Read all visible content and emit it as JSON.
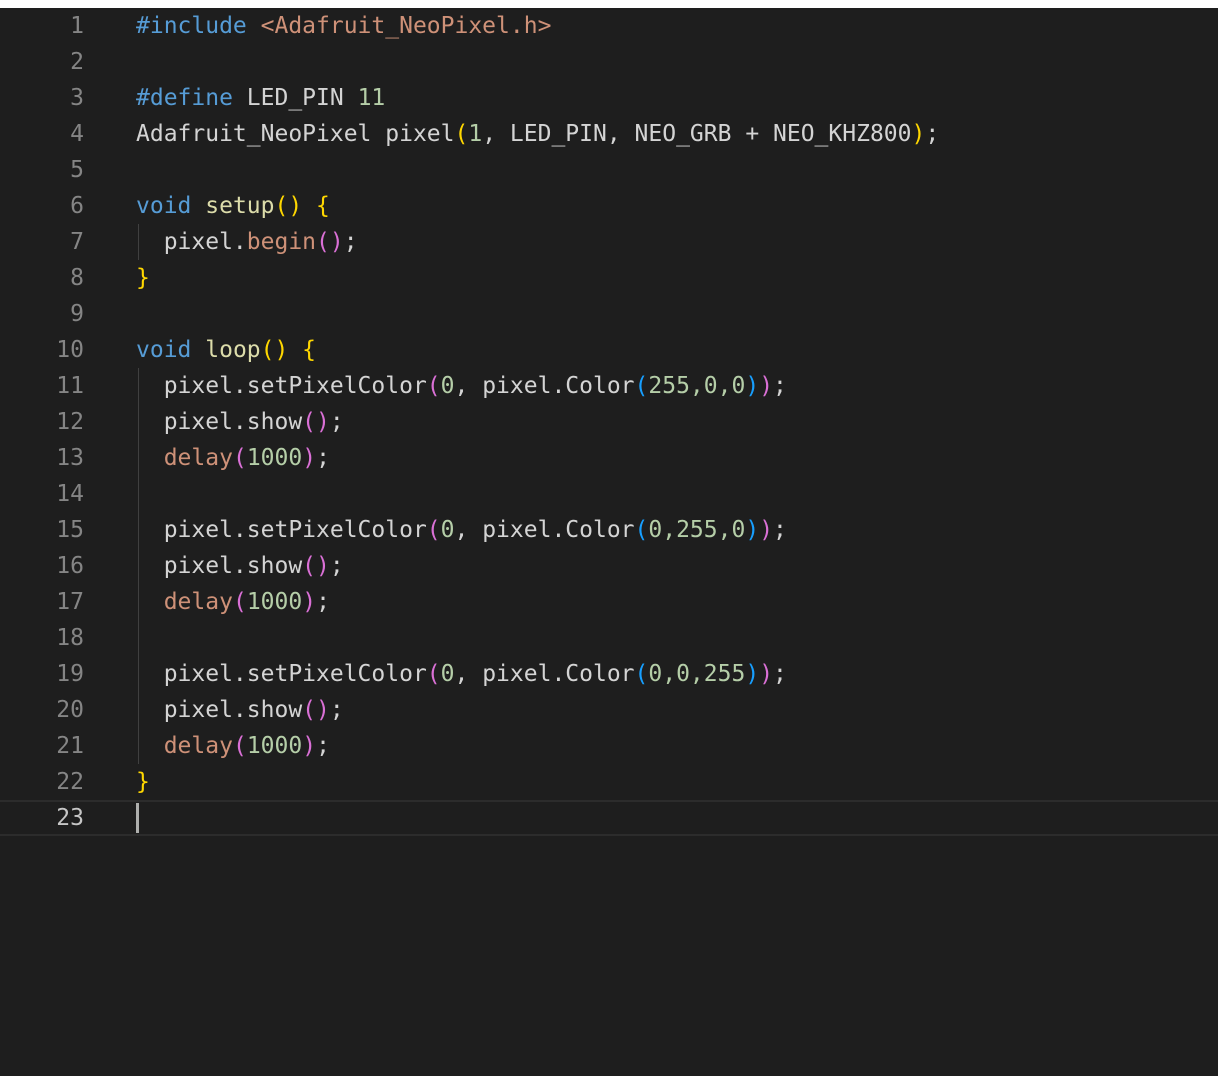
{
  "colors": {
    "background": "#1e1e1e",
    "line_number": "#858585",
    "line_number_active": "#c6c6c6",
    "default": "#d4d4d4",
    "keyword": "#569cd6",
    "string": "#ce9178",
    "number": "#b5cea8",
    "function": "#dcdcaa",
    "method": "#ce9178",
    "bracket_gold": "#ffd700",
    "bracket_purple": "#da70d6",
    "bracket_blue": "#179fff"
  },
  "editor": {
    "active_line": 23,
    "lines": [
      {
        "n": "1",
        "tokens": [
          {
            "t": "#include ",
            "c": "keyword"
          },
          {
            "t": "<Adafruit_NeoPixel.h>",
            "c": "string"
          }
        ]
      },
      {
        "n": "2",
        "tokens": []
      },
      {
        "n": "3",
        "tokens": [
          {
            "t": "#define ",
            "c": "keyword"
          },
          {
            "t": "LED_PIN ",
            "c": "default"
          },
          {
            "t": "11",
            "c": "number"
          }
        ]
      },
      {
        "n": "4",
        "tokens": [
          {
            "t": "Adafruit_NeoPixel pixel",
            "c": "default"
          },
          {
            "t": "(",
            "c": "bracket_gold"
          },
          {
            "t": "1",
            "c": "number"
          },
          {
            "t": ", LED_PIN, NEO_GRB + NEO_KHZ800",
            "c": "default"
          },
          {
            "t": ")",
            "c": "bracket_gold"
          },
          {
            "t": ";",
            "c": "default"
          }
        ]
      },
      {
        "n": "5",
        "tokens": []
      },
      {
        "n": "6",
        "tokens": [
          {
            "t": "void ",
            "c": "keyword"
          },
          {
            "t": "setup",
            "c": "function"
          },
          {
            "t": "() {",
            "c": "bracket_gold"
          }
        ]
      },
      {
        "n": "7",
        "tokens": [
          {
            "t": "  pixel.",
            "c": "default"
          },
          {
            "t": "begin",
            "c": "method"
          },
          {
            "t": "()",
            "c": "bracket_purple"
          },
          {
            "t": ";",
            "c": "default"
          }
        ]
      },
      {
        "n": "8",
        "tokens": [
          {
            "t": "}",
            "c": "bracket_gold"
          }
        ]
      },
      {
        "n": "9",
        "tokens": []
      },
      {
        "n": "10",
        "tokens": [
          {
            "t": "void ",
            "c": "keyword"
          },
          {
            "t": "loop",
            "c": "function"
          },
          {
            "t": "() {",
            "c": "bracket_gold"
          }
        ]
      },
      {
        "n": "11",
        "tokens": [
          {
            "t": "  pixel.setPixelColor",
            "c": "default"
          },
          {
            "t": "(",
            "c": "bracket_purple"
          },
          {
            "t": "0",
            "c": "number"
          },
          {
            "t": ", pixel.Color",
            "c": "default"
          },
          {
            "t": "(",
            "c": "bracket_blue"
          },
          {
            "t": "255,0,0",
            "c": "number"
          },
          {
            "t": ")",
            "c": "bracket_blue"
          },
          {
            "t": ")",
            "c": "bracket_purple"
          },
          {
            "t": ";",
            "c": "default"
          }
        ]
      },
      {
        "n": "12",
        "tokens": [
          {
            "t": "  pixel.show",
            "c": "default"
          },
          {
            "t": "()",
            "c": "bracket_purple"
          },
          {
            "t": ";",
            "c": "default"
          }
        ]
      },
      {
        "n": "13",
        "tokens": [
          {
            "t": "  ",
            "c": "default"
          },
          {
            "t": "delay",
            "c": "method"
          },
          {
            "t": "(",
            "c": "bracket_purple"
          },
          {
            "t": "1000",
            "c": "number"
          },
          {
            "t": ")",
            "c": "bracket_purple"
          },
          {
            "t": ";",
            "c": "default"
          }
        ]
      },
      {
        "n": "14",
        "tokens": []
      },
      {
        "n": "15",
        "tokens": [
          {
            "t": "  pixel.setPixelColor",
            "c": "default"
          },
          {
            "t": "(",
            "c": "bracket_purple"
          },
          {
            "t": "0",
            "c": "number"
          },
          {
            "t": ", pixel.Color",
            "c": "default"
          },
          {
            "t": "(",
            "c": "bracket_blue"
          },
          {
            "t": "0,255,0",
            "c": "number"
          },
          {
            "t": ")",
            "c": "bracket_blue"
          },
          {
            "t": ")",
            "c": "bracket_purple"
          },
          {
            "t": ";",
            "c": "default"
          }
        ]
      },
      {
        "n": "16",
        "tokens": [
          {
            "t": "  pixel.show",
            "c": "default"
          },
          {
            "t": "()",
            "c": "bracket_purple"
          },
          {
            "t": ";",
            "c": "default"
          }
        ]
      },
      {
        "n": "17",
        "tokens": [
          {
            "t": "  ",
            "c": "default"
          },
          {
            "t": "delay",
            "c": "method"
          },
          {
            "t": "(",
            "c": "bracket_purple"
          },
          {
            "t": "1000",
            "c": "number"
          },
          {
            "t": ")",
            "c": "bracket_purple"
          },
          {
            "t": ";",
            "c": "default"
          }
        ]
      },
      {
        "n": "18",
        "tokens": []
      },
      {
        "n": "19",
        "tokens": [
          {
            "t": "  pixel.setPixelColor",
            "c": "default"
          },
          {
            "t": "(",
            "c": "bracket_purple"
          },
          {
            "t": "0",
            "c": "number"
          },
          {
            "t": ", pixel.Color",
            "c": "default"
          },
          {
            "t": "(",
            "c": "bracket_blue"
          },
          {
            "t": "0,0,255",
            "c": "number"
          },
          {
            "t": ")",
            "c": "bracket_blue"
          },
          {
            "t": ")",
            "c": "bracket_purple"
          },
          {
            "t": ";",
            "c": "default"
          }
        ]
      },
      {
        "n": "20",
        "tokens": [
          {
            "t": "  pixel.show",
            "c": "default"
          },
          {
            "t": "()",
            "c": "bracket_purple"
          },
          {
            "t": ";",
            "c": "default"
          }
        ]
      },
      {
        "n": "21",
        "tokens": [
          {
            "t": "  ",
            "c": "default"
          },
          {
            "t": "delay",
            "c": "method"
          },
          {
            "t": "(",
            "c": "bracket_purple"
          },
          {
            "t": "1000",
            "c": "number"
          },
          {
            "t": ")",
            "c": "bracket_purple"
          },
          {
            "t": ";",
            "c": "default"
          }
        ]
      },
      {
        "n": "22",
        "tokens": [
          {
            "t": "}",
            "c": "bracket_gold"
          }
        ]
      },
      {
        "n": "23",
        "tokens": []
      }
    ]
  }
}
